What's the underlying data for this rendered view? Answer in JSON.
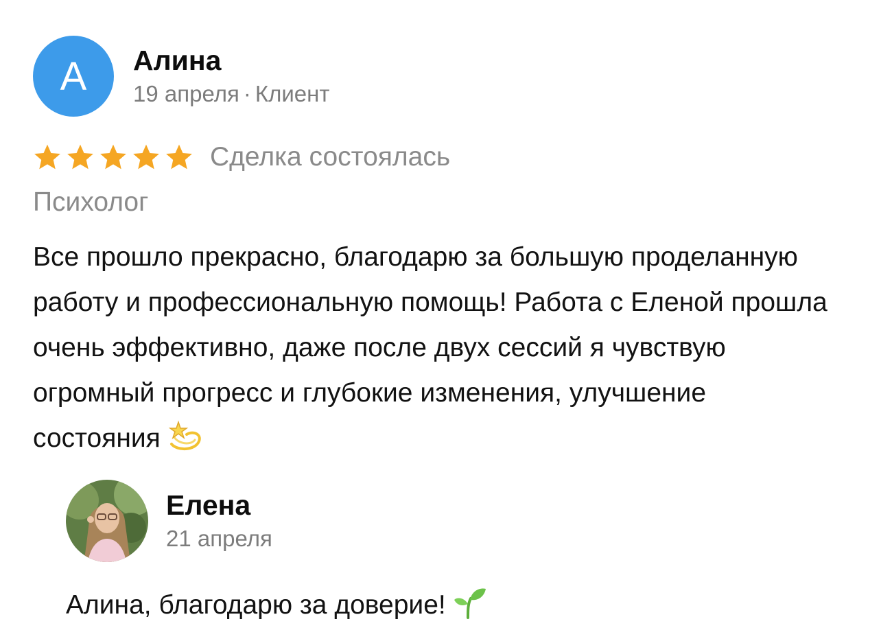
{
  "review": {
    "avatar_letter": "А",
    "avatar_color": "#3d9bea",
    "author_name": "Алина",
    "date": "19 апреля",
    "separator": "·",
    "role": "Клиент",
    "rating": 5,
    "rating_max": 5,
    "star_color": "#f5a623",
    "deal_status": "Сделка состоялась",
    "category": "Психолог",
    "text": "Все прошло прекрасно, благодарю за большую проделанную работу и профессиональную помощь! Работа с Еленой прошла очень эффективно, даже после двух сессий я чувствую огромный прогресс и глубокие изменения, улучшение состояния",
    "text_emoji": "dizzy-star-emoji"
  },
  "reply": {
    "author_name": "Елена",
    "date": "21 апреля",
    "avatar": "photo-avatar",
    "text": "Алина, благодарю за доверие!",
    "text_emoji": "seedling-emoji"
  }
}
